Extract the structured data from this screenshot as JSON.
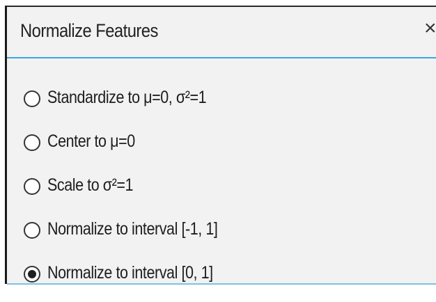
{
  "dialog": {
    "title": "Normalize Features",
    "close_glyph": "×"
  },
  "options": [
    {
      "label": "Standardize to μ=0, σ²=1",
      "selected": false
    },
    {
      "label": "Center to μ=0",
      "selected": false
    },
    {
      "label": "Scale to σ²=1",
      "selected": false
    },
    {
      "label": "Normalize to interval [-1, 1]",
      "selected": false
    },
    {
      "label": "Normalize to interval [0, 1]",
      "selected": true
    }
  ],
  "colors": {
    "accent": "#3aa6e0",
    "panel_background": "#f2f2f2",
    "text": "#1e1e1e"
  }
}
